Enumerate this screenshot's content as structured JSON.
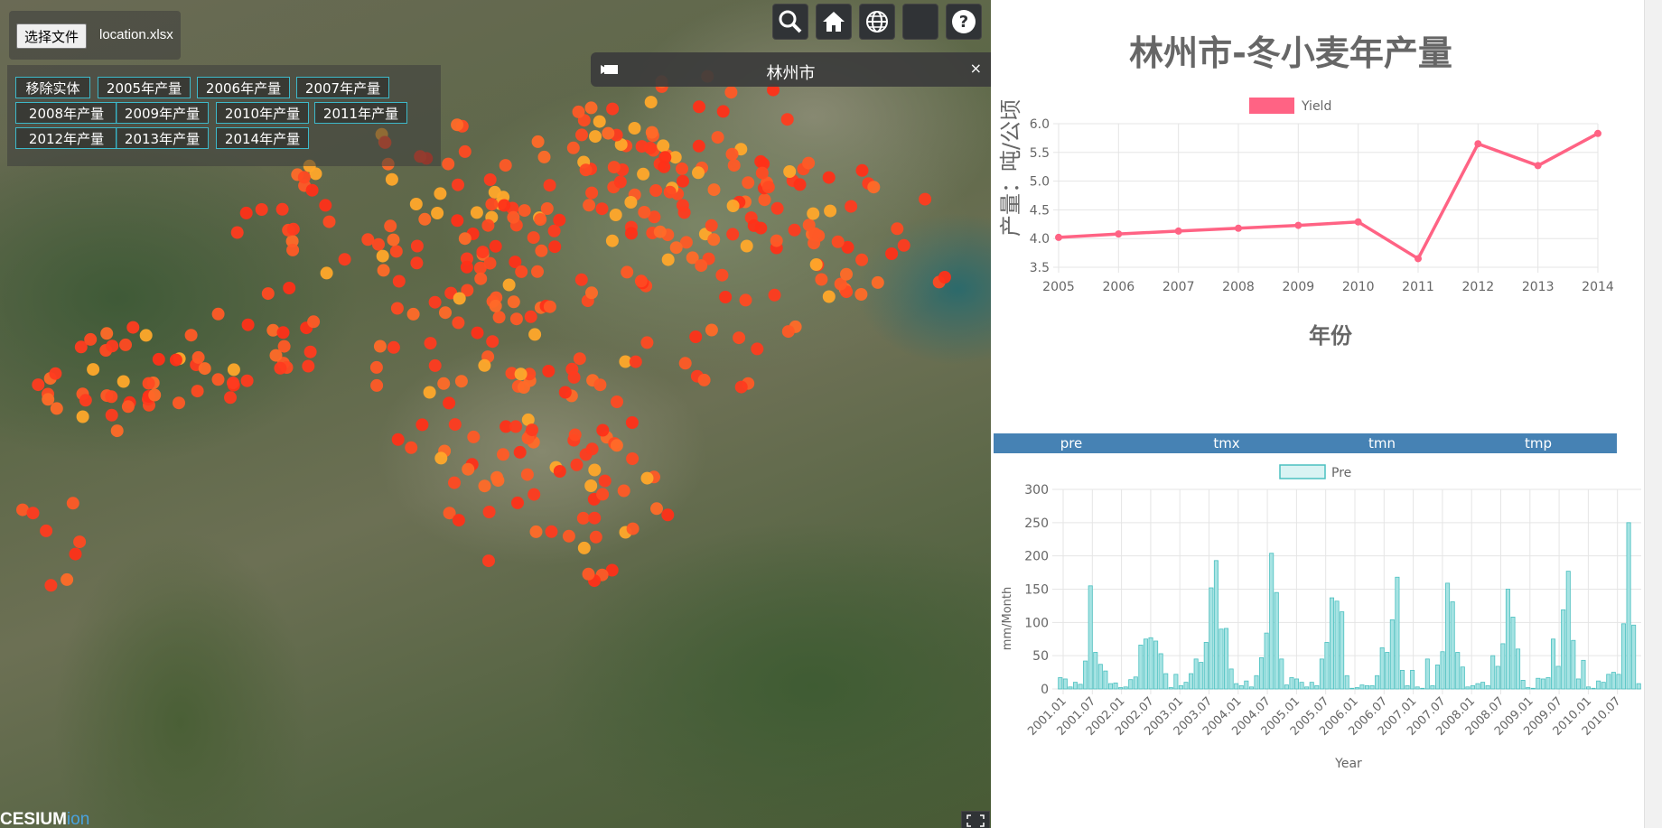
{
  "file_upload": {
    "button_label": "选择文件",
    "file_name": "location.xlsx"
  },
  "year_buttons": [
    "移除实体",
    "2005年产量",
    "2006年产量",
    "2007年产量",
    "2008年产量",
    "2009年产量",
    "2010年产量",
    "2011年产量",
    "2012年产量",
    "2013年产量",
    "2014年产量"
  ],
  "toolbar": {
    "icons": [
      "search-icon",
      "home-icon",
      "globe-icon",
      "blank-icon",
      "help-icon"
    ]
  },
  "infobox": {
    "title": "林州市",
    "close_label": "×"
  },
  "cesium_logo": {
    "brand": "CESIUM",
    "suffix": "ion"
  },
  "yield_chart": {
    "chart_data": {
      "type": "line",
      "title": "林州市-冬小麦年产量",
      "xlabel": "年份",
      "ylabel": "产量：吨/公顷",
      "legend": "Yield",
      "legend_position": "top",
      "color": "#ff6384",
      "categories": [
        "2005",
        "2006",
        "2007",
        "2008",
        "2009",
        "2010",
        "2011",
        "2012",
        "2013",
        "2014"
      ],
      "values": [
        4.02,
        4.08,
        4.13,
        4.18,
        4.23,
        4.29,
        3.65,
        5.65,
        5.27,
        5.83
      ],
      "ylim": [
        3.5,
        6.0
      ],
      "yticks": [
        "3.5",
        "4.0",
        "4.5",
        "5.0",
        "5.5",
        "6.0"
      ],
      "grid": true
    }
  },
  "climate_tabs": [
    "pre",
    "tmx",
    "tmn",
    "tmp"
  ],
  "climate_chart": {
    "chart_data": {
      "type": "bar",
      "legend": "Pre",
      "legend_position": "top",
      "xlabel": "Year",
      "ylabel": "mm/Month",
      "ylim": [
        0,
        300
      ],
      "yticks": [
        "0",
        "50",
        "100",
        "150",
        "200",
        "250",
        "300"
      ],
      "grid": true,
      "color": "#4bc0c0",
      "fill": "#a6e3e3",
      "tick_labels": [
        "2001.01",
        "2001.07",
        "2002.01",
        "2002.07",
        "2003.01",
        "2003.07",
        "2004.01",
        "2004.07",
        "2005.01",
        "2005.07",
        "2006.01",
        "2006.07",
        "2007.01",
        "2007.07",
        "2008.01",
        "2008.07",
        "2009.01",
        "2009.07",
        "2010.01",
        "2010.07"
      ],
      "values": [
        17,
        15,
        3,
        10,
        7,
        42,
        155,
        55,
        37,
        27,
        8,
        9,
        2,
        3,
        14,
        18,
        66,
        75,
        77,
        72,
        53,
        23,
        2,
        22,
        5,
        10,
        23,
        45,
        40,
        70,
        152,
        193,
        90,
        91,
        30,
        8,
        5,
        12,
        3,
        20,
        47,
        84,
        204,
        145,
        45,
        6,
        17,
        15,
        10,
        3,
        10,
        5,
        45,
        70,
        137,
        132,
        116,
        20,
        1,
        2,
        6,
        5,
        5,
        20,
        62,
        55,
        104,
        168,
        28,
        5,
        28,
        3,
        1,
        45,
        5,
        36,
        56,
        159,
        131,
        55,
        33,
        3,
        5,
        8,
        10,
        5,
        50,
        34,
        68,
        150,
        108,
        60,
        13,
        2,
        1,
        16,
        15,
        17,
        75,
        34,
        119,
        177,
        73,
        15,
        43,
        3,
        1,
        12,
        10,
        22,
        25,
        22,
        98,
        250,
        96,
        8
      ]
    }
  }
}
